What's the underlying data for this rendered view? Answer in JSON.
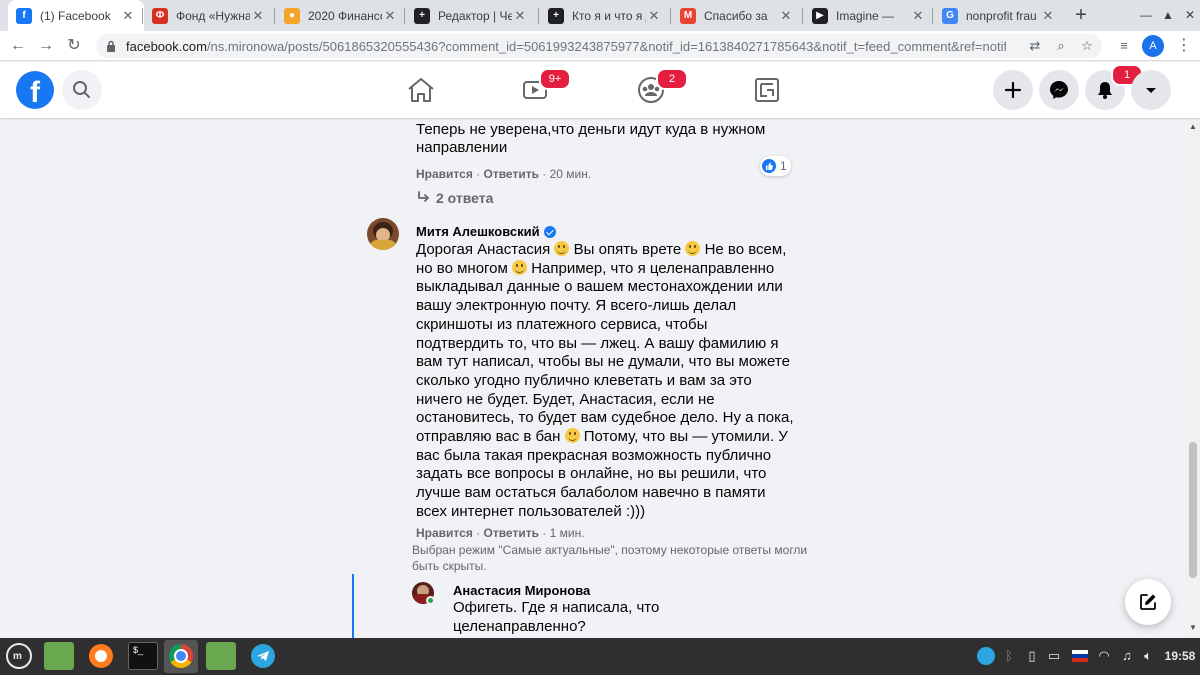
{
  "browser": {
    "tabs": [
      {
        "title": "(1) Facebook",
        "icon": "facebook-icon",
        "color": "#1877f2",
        "glyph": "f"
      },
      {
        "title": "Фонд «Нужна",
        "icon": "fund-icon",
        "color": "#d93025",
        "glyph": "Ф"
      },
      {
        "title": "2020 Финансо",
        "icon": "dots-icon",
        "color": "#f4a62a",
        "glyph": "●"
      },
      {
        "title": "Редактор | Че",
        "icon": "editor-plus-icon",
        "color": "#202124",
        "glyph": "+"
      },
      {
        "title": "Кто я и что я д",
        "icon": "editor-plus-icon",
        "color": "#202124",
        "glyph": "+"
      },
      {
        "title": "Спасибо за",
        "icon": "gmail-icon",
        "color": "#ea4335",
        "glyph": "M"
      },
      {
        "title": "Imagine — ",
        "icon": "youtube-play-icon",
        "color": "#202124",
        "glyph": "▶"
      },
      {
        "title": "nonprofit frau",
        "icon": "google-icon",
        "color": "#4285f4",
        "glyph": "G"
      }
    ],
    "tab_close": "✕",
    "new_tab": "+",
    "address": {
      "host": "facebook.com",
      "path": "/ns.mironowa/posts/5061865320555436?comment_id=5061993243875977&notif_id=1613840271785643&notif_t=feed_comment&ref=notif"
    },
    "profile_initial": "A"
  },
  "facebook": {
    "badges": {
      "watch": "9+",
      "groups": "2",
      "notifications": "1"
    }
  },
  "comments": {
    "first": {
      "cut_off_line": "...",
      "text_lines": [
        "Теперь не уверена,что деньги идут куда в нужном",
        "направлении"
      ],
      "like_label": "Нравится",
      "reply_label": "Ответить",
      "time": "20 мин.",
      "reaction_count": "1"
    },
    "replies_toggle": "2 ответа",
    "second": {
      "author": "Митя Алешковский",
      "lines": [
        [
          "Дорогая Анастасия ",
          ":) ",
          "Вы опять врете ",
          ":) ",
          "Не во всем,"
        ],
        [
          "но во многом ",
          ":) ",
          "Например, что я целенаправленно"
        ],
        [
          "выкладывал данные о вашем местонахождении или"
        ],
        [
          "вашу электронную почту. Я всего-лишь делал"
        ],
        [
          "скриншоты из платежного сервиса, чтобы"
        ],
        [
          "подтвердить то, что вы — лжец. А вашу фамилию я"
        ],
        [
          "вам тут написал, чтобы вы не думали, что вы можете"
        ],
        [
          "сколько угодно публично клеветать и вам за это"
        ],
        [
          "ничего не будет. Будет, Анастасия, если не"
        ],
        [
          "остановитесь, то будет вам судебное дело. Ну а пока,"
        ],
        [
          "отправляю вас в бан ",
          ":) ",
          "Потому, что вы — утомили. У"
        ],
        [
          "вас была такая прекрасная возможность публично"
        ],
        [
          "задать все вопросы в онлайне, но вы решили, что"
        ],
        [
          "лучше вам остаться балаболом навечно в памяти"
        ],
        [
          "всех интернет пользователей :)))"
        ]
      ],
      "like_label": "Нравится",
      "reply_label": "Ответить",
      "time": "1 мин."
    },
    "filter_notice_lines": [
      "Выбран режим \"Самые актуальные\", поэтому некоторые ответы могли",
      "быть скрыты."
    ],
    "third": {
      "author": "Анастасия Миронова",
      "text_lines": [
        "Офигеть. Где я написала, что",
        "целенаправленно?"
      ]
    }
  },
  "taskbar": {
    "clock": "19:58"
  },
  "colors": {
    "fb_blue": "#1877f2",
    "badge_red": "#e41e3f",
    "meta_gray": "#65676b",
    "bubble_gray": "#f0f2f5"
  }
}
